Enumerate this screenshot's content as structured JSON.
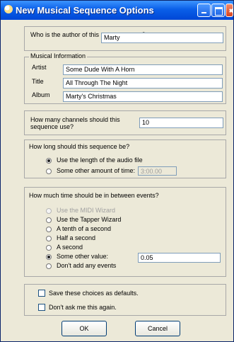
{
  "window": {
    "title": "New Musical Sequence Options"
  },
  "author": {
    "question": "Who is the author of this new sequence?",
    "value": "Marty"
  },
  "musical_info": {
    "title": "Musical Information",
    "artist_label": "Artist",
    "artist_value": "Some Dude With A Horn",
    "title_label": "Title",
    "title_value": "All Through The Night",
    "album_label": "Album",
    "album_value": "Marty's Christmas"
  },
  "channels": {
    "question": "How many channels should this sequence use?",
    "value": "10"
  },
  "length": {
    "question": "How long should this sequence be?",
    "option1": "Use the length of the audio file",
    "option2": "Some other amount of time:",
    "time_value": "3:00.00"
  },
  "events": {
    "question": "How much time should be in between events?",
    "options": [
      "Use the MIDI Wizard",
      "Use the Tapper Wizard",
      "A tenth of a second",
      "Half a second",
      "A second",
      "Some other value:",
      "Don't add any events"
    ],
    "other_value": "0.05"
  },
  "options": {
    "save_defaults": "Save these choices as defaults.",
    "dont_ask": "Don't ask me this again."
  },
  "buttons": {
    "ok": "OK",
    "cancel": "Cancel"
  }
}
